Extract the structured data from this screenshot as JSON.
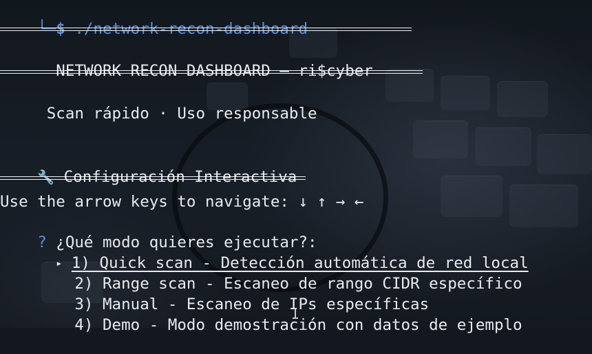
{
  "prompt": {
    "corner": "└─",
    "symbol": "$",
    "command": "./network-recon-dashboard"
  },
  "banner": {
    "title": "NETWORK RECON DASHBOARD — ri$cyber",
    "subtitle": "Scan rápido · Uso responsable"
  },
  "config": {
    "icon": "wrench-icon",
    "heading": "Configuración Interactiva"
  },
  "menu": {
    "instructions": "Use the arrow keys to navigate: ↓ ↑ → ←",
    "question_mark": "?",
    "question": "¿Qué modo quieres ejecutar?:",
    "pointer": "▸",
    "options": [
      {
        "label": "1) Quick scan - Detección automática de red local",
        "selected": true
      },
      {
        "label": "2) Range scan - Escaneo de rango CIDR específico",
        "selected": false
      },
      {
        "label": "3) Manual - Escaneo de IPs específicas",
        "selected": false
      },
      {
        "label": "4) Demo - Modo demostración con datos de ejemplo",
        "selected": false
      }
    ]
  },
  "colors": {
    "prompt": "#5a8fd8",
    "text": "#e8eaee",
    "background": "#131820"
  }
}
